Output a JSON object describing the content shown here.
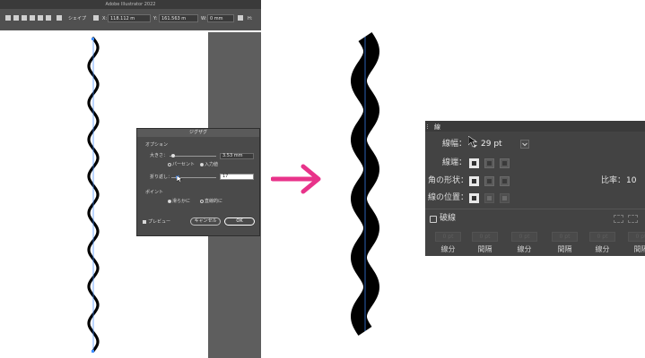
{
  "app": {
    "title": "Adobe Illustrator 2022"
  },
  "control_bar": {
    "shape_label": "シェイプ",
    "x_label": "X:",
    "x_value": "118.112 m",
    "y_label": "Y:",
    "y_value": "161.563 m",
    "w_label": "W:",
    "w_value": "0 mm",
    "h_label": "H:"
  },
  "zigzag_dialog": {
    "title": "ジグザグ",
    "options_heading": "オプション",
    "size_label": "大きさ：",
    "size_value": "3.53 mm",
    "relative_label": "パーセント",
    "absolute_label": "入力値",
    "ridges_label": "折り返し：",
    "ridges_value": "17",
    "points_heading": "ポイント",
    "smooth_label": "滑らかに",
    "corner_label": "直線的に",
    "preview_label": "プレビュー",
    "cancel_label": "キャンセル",
    "ok_label": "OK"
  },
  "stroke_panel": {
    "tab_label": "線",
    "weight_label": "線幅：",
    "weight_value": "29 pt",
    "cap_label": "線端：",
    "corner_label": "角の形状：",
    "limit_label": "比率：",
    "limit_value": "10",
    "align_label": "線の位置：",
    "dashed_label": "破線",
    "dash_labels": [
      "線分",
      "間隔",
      "線分",
      "間隔",
      "線分",
      "間隔"
    ],
    "dash_placeholder": "0 pt"
  },
  "colors": {
    "accent_arrow": "#e8338a",
    "panel_bg": "#434343",
    "selection": "#3f8cff"
  }
}
